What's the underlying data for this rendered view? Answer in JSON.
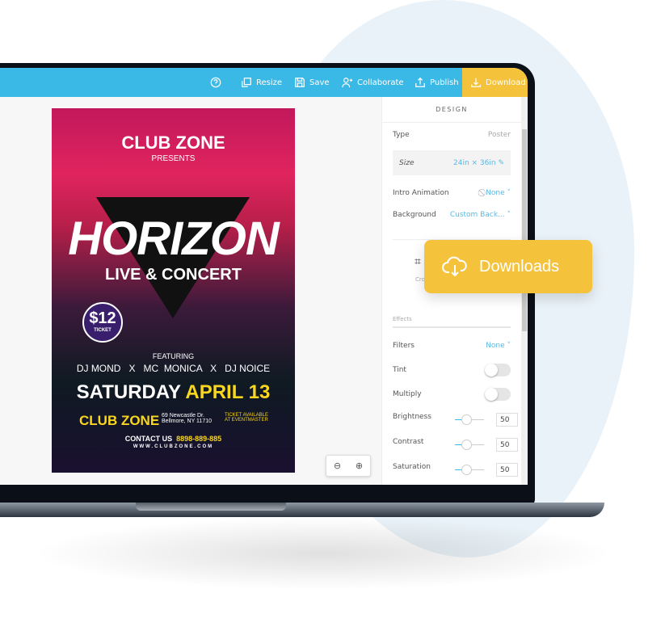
{
  "toolbar": {
    "help_icon": "question-circle-icon",
    "items": [
      {
        "label": "Resize",
        "icon": "resize-icon"
      },
      {
        "label": "Save",
        "icon": "save-icon"
      },
      {
        "label": "Collaborate",
        "icon": "add-user-icon"
      },
      {
        "label": "Publish",
        "icon": "upload-icon"
      },
      {
        "label": "Download",
        "icon": "download-icon"
      }
    ]
  },
  "panel": {
    "title": "DESIGN",
    "type_label": "Type",
    "type_value": "Poster",
    "size_label": "Size",
    "size_value": "24in × 36in",
    "intro_label": "Intro Animation",
    "intro_value": "None",
    "background_label": "Background",
    "background_value": "Custom Back...",
    "crop_label": "Crop",
    "effects_label": "Effects",
    "filters_label": "Filters",
    "filters_value": "None",
    "tint_label": "Tint",
    "tint_on": false,
    "multiply_label": "Multiply",
    "multiply_on": false,
    "sliders": [
      {
        "label": "Brightness",
        "value": "50"
      },
      {
        "label": "Contrast",
        "value": "50"
      },
      {
        "label": "Saturation",
        "value": "50"
      }
    ]
  },
  "poster": {
    "top": "CLUB ZONE",
    "presents": "PRESENTS",
    "title": "HORIZON",
    "subtitle": "LIVE & CONCERT",
    "price": "$12",
    "ticket": "TICKET",
    "featuring": "FEATURING",
    "artists": "DJ MOND   X   MC  MONICA   X   DJ NOICE",
    "day": "SATURDAY",
    "date": "APRIL 13",
    "venue": "CLUB ZONE",
    "address1": "69 Newcastle Dr.",
    "address2": "Bellmore, NY 11710",
    "ticket1": "TICKET AVAILABLE",
    "ticket2": "AT EVENTMASTER",
    "contact": "CONTACT US",
    "phone": "8898-889-885",
    "web": "WWW.CLUBZONE.COM"
  },
  "popup": {
    "label": "Downloads",
    "icon": "cloud-download-icon"
  },
  "colors": {
    "header": "#3bb9e6",
    "accent": "#f4c23b"
  }
}
